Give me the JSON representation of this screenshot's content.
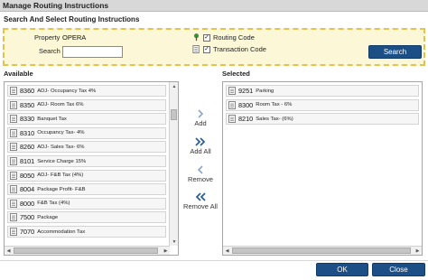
{
  "window": {
    "title": "Manage Routing Instructions"
  },
  "section_title": "Search And Select Routing Instructions",
  "criteria": {
    "property_label": "Property",
    "property_value": "OPERA",
    "search_label": "Search",
    "search_value": "",
    "routing_code_label": "Routing Code",
    "routing_code_checked": true,
    "transaction_code_label": "Transaction Code",
    "transaction_code_checked": true,
    "search_button": "Search"
  },
  "available": {
    "title": "Available",
    "items": [
      {
        "code": "8360",
        "desc": "ADJ- Occupancy Tax 4%"
      },
      {
        "code": "8350",
        "desc": "ADJ- Room Tax 6%"
      },
      {
        "code": "8330",
        "desc": "Banquet Tax"
      },
      {
        "code": "8310",
        "desc": "Occupancy Tax- 4%"
      },
      {
        "code": "8260",
        "desc": "ADJ- Sales Tax- 6%"
      },
      {
        "code": "8101",
        "desc": "Service Charge 15%"
      },
      {
        "code": "8050",
        "desc": "ADJ- F&B Tax (4%)"
      },
      {
        "code": "8004",
        "desc": "Package Profit- F&B"
      },
      {
        "code": "8000",
        "desc": "F&B Tax (4%)"
      },
      {
        "code": "7500",
        "desc": "Package"
      },
      {
        "code": "7070",
        "desc": "Accommodation Tax"
      }
    ]
  },
  "selected": {
    "title": "Selected",
    "items": [
      {
        "code": "9251",
        "desc": "Parking"
      },
      {
        "code": "8300",
        "desc": "Room Tax - 6%"
      },
      {
        "code": "8210",
        "desc": "Sales Tax- (6%)"
      }
    ]
  },
  "move_buttons": {
    "add": "Add",
    "add_all": "Add All",
    "remove": "Remove",
    "remove_all": "Remove All"
  },
  "footer": {
    "ok": "OK",
    "close": "Close"
  },
  "icons": {
    "routing_code": "tree-icon",
    "transaction_code": "document-icon",
    "list_item": "document-icon",
    "add": "chevron-right-icon",
    "add_all": "double-chevron-right-icon",
    "remove": "chevron-left-icon",
    "remove_all": "double-chevron-left-icon"
  },
  "colors": {
    "accent": "#1c4f86",
    "criteria_bg": "#fbf7d7",
    "criteria_border": "#e5c24e",
    "arrow": "#2c5e9a"
  }
}
